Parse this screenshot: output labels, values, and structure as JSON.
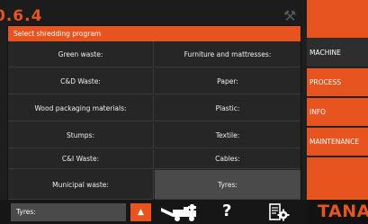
{
  "dialog": {
    "title": "Select shredding program",
    "programs_left": [
      "Green waste:",
      "C&D Waste:",
      "Wood packaging materials:",
      "Stumps:",
      "C&I Waste:",
      "Municipal waste:"
    ],
    "programs_right": [
      "Furniture and mattresses:",
      "Paper:",
      "Plastic:",
      "Textile:",
      "Cables:",
      "Tyres:"
    ],
    "selected": "Tyres:"
  },
  "sidebar": {
    "tabs": [
      "MACHINE",
      "PROCESS",
      "INFO",
      "MAINTENANCE"
    ],
    "logo": "TANA"
  },
  "toolbar": {
    "current_program": "Tyres:",
    "help": "?",
    "icons": [
      "chevron-up-icon",
      "machine-icon",
      "help-icon",
      "settings-icon"
    ]
  },
  "background": {
    "status_digits": "0.6.4"
  },
  "colors": {
    "accent": "#e8541f",
    "panel": "#262626",
    "selected": "#4a4a4a"
  }
}
